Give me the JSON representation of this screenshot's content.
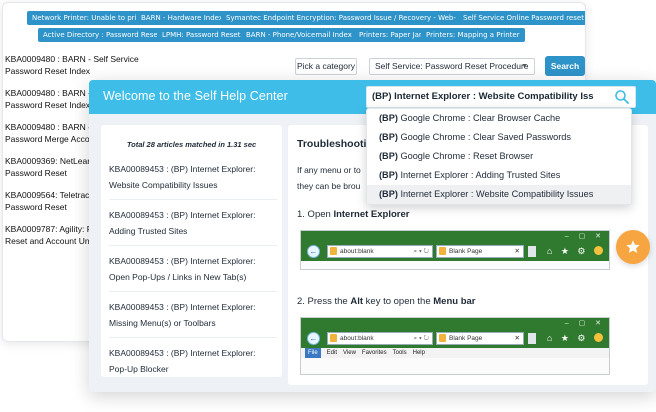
{
  "back_window": {
    "tags": [
      "Network Printer: Unable to print",
      "BARN - Hardware Index",
      "Symantec Endpoint Encryption: Password Issue / Recovery - Web- based",
      "Self Service Online Password reset",
      "Active Directory : Password Reset Accou",
      "LPMH: Password Reset",
      "BARN - Phone/Voicemail Index",
      "Printers: Paper Jam",
      "Printers: Mapping a Printer"
    ],
    "pick_category": "Pick a category",
    "selected_category": "Self Service: Password Reset Procedure",
    "search_button": "Search",
    "articles": [
      [
        "KBA0009480 : BARN - Self Service",
        "Password Reset Index"
      ],
      [
        "KBA0009480 : BARN - S",
        "Password Reset Index"
      ],
      [
        "KBA0009480 : BARN - C",
        "Password Merge Accou"
      ],
      [
        "KBA0009369: NetLearn",
        "Password Reset"
      ],
      [
        "KBA0009564: Teletrack",
        "Password Reset"
      ],
      [
        "KBA0009787: Agility: P",
        "Reset and Account Unl"
      ]
    ]
  },
  "front_window": {
    "title": "Welcome to the Self Help Center",
    "search_value": "(BP) Internet Explorer : Website Compatibility Iss",
    "match_text": "Total 28 articles matched in 1.31 sec",
    "articles": [
      [
        "KBA00089453 : (BP) Internet Explorer:",
        "Website Compatibility Issues"
      ],
      [
        "KBA00089453 : (BP) Internet Explorer:",
        "Adding Trusted Sites"
      ],
      [
        "KBA00089453 : (BP) Internet Explorer:",
        "Open Pop-Ups / Links in New Tab(s)"
      ],
      [
        "KBA00089453 : (BP) Internet Explorer:",
        "Missing Menu(s) or Toolbars"
      ],
      [
        "KBA00089453 : (BP) Internet Explorer:",
        "Pop-Up Blocker"
      ]
    ],
    "doc": {
      "title": "Troubleshootin",
      "para_line1": "If any menu or to",
      "para_line2": "they can be brou",
      "step1_prefix": "1. Open ",
      "step1_bold": "Internet Explorer",
      "step2_prefix": "2. Press the ",
      "step2_bold1": "Alt",
      "step2_mid": " key to open the ",
      "step2_bold2": "Menu bar"
    },
    "ie_window_controls": "– ▢ ✕",
    "ie_address": "about:blank",
    "ie_address_controls": "⌕ ▾ ↻",
    "ie_tab_label": "Blank Page",
    "ie_tab_close": "✕",
    "ie_toolbar_icons": "⌂ ★ ⚙",
    "ie_menu": [
      "File",
      "Edit",
      "View",
      "Favorites",
      "Tools",
      "Help"
    ]
  },
  "dropdown": {
    "items": [
      {
        "prefix": "(BP)",
        "text": " Google Chrome : Clear Browser Cache"
      },
      {
        "prefix": "(BP)",
        "text": " Google Chrome : Clear Saved Passwords"
      },
      {
        "prefix": "(BP)",
        "text": " Google Chrome : Reset Browser"
      },
      {
        "prefix": "(BP)",
        "text": " Internet Explorer : Adding Trusted Sites"
      },
      {
        "prefix": "(BP)",
        "text": " Internet Explorer : Website Compatibility Issues"
      }
    ]
  },
  "colors": {
    "header": "#3dbde8",
    "tag": "#2e93c8",
    "accent_orange": "#f7a541"
  },
  "icons": {
    "search": "search-icon",
    "star": "star-icon"
  }
}
